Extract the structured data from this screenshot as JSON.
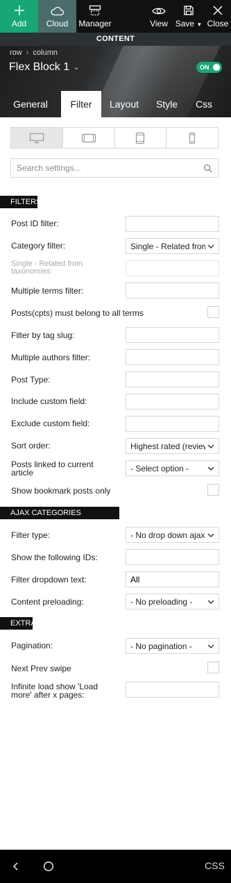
{
  "toolbar": {
    "add": "Add",
    "cloud": "Cloud",
    "manager": "Manager",
    "view": "View",
    "save": "Save",
    "close": "Close"
  },
  "content_bar": "CONTENT",
  "breadcrumb": {
    "row": "row",
    "column": "column"
  },
  "block_title": "Flex Block 1",
  "toggle_label": "ON",
  "tabs": [
    "General",
    "Filter",
    "Layout",
    "Style",
    "Css"
  ],
  "search": {
    "placeholder": "Search settings..."
  },
  "sections": {
    "filters": "FILTERS",
    "ajax": "AJAX CATEGORIES DROPDOWN",
    "extra": "EXTRA"
  },
  "filters": {
    "post_id": {
      "label": "Post ID filter:",
      "value": ""
    },
    "category": {
      "label": "Category filter:",
      "value": "Single - Related from taxonomies"
    },
    "single_related": {
      "label": "Single - Related from taxonomies:",
      "value": ""
    },
    "multiple_terms": {
      "label": "Multiple terms filter:",
      "value": ""
    },
    "must_belong": {
      "label": "Posts(cpts) must belong to all terms"
    },
    "tag_slug": {
      "label": "Filter by tag slug:",
      "value": ""
    },
    "multiple_authors": {
      "label": "Multiple authors filter:",
      "value": ""
    },
    "post_type": {
      "label": "Post Type:",
      "value": ""
    },
    "include_cf": {
      "label": "Include custom field:",
      "value": ""
    },
    "exclude_cf": {
      "label": "Exclude custom field:",
      "value": ""
    },
    "sort_order": {
      "label": "Sort order:",
      "value": "Highest rated (reviews)"
    },
    "linked_article": {
      "label": "Posts linked to current article",
      "value": "- Select option -"
    },
    "bookmark": {
      "label": "Show bookmark posts only"
    }
  },
  "ajax": {
    "filter_type": {
      "label": "Filter type:",
      "value": "- No drop down ajax filter -"
    },
    "show_ids": {
      "label": "Show the following IDs:",
      "value": ""
    },
    "dropdown_text": {
      "label": "Filter dropdown text:",
      "value": "All"
    },
    "preloading": {
      "label": "Content preloading:",
      "value": "- No preloading -"
    }
  },
  "extra": {
    "pagination": {
      "label": "Pagination:",
      "value": "- No pagination -"
    },
    "next_prev_swipe": {
      "label": "Next Prev swipe"
    },
    "infinite_load": {
      "label": "Infinite load show 'Load more' after x pages:",
      "value": ""
    }
  },
  "navbar": {
    "css_label": "CSS"
  },
  "colors": {
    "accent": "#17a776",
    "cloud": "#4a6d6b",
    "dark": "#111111"
  }
}
